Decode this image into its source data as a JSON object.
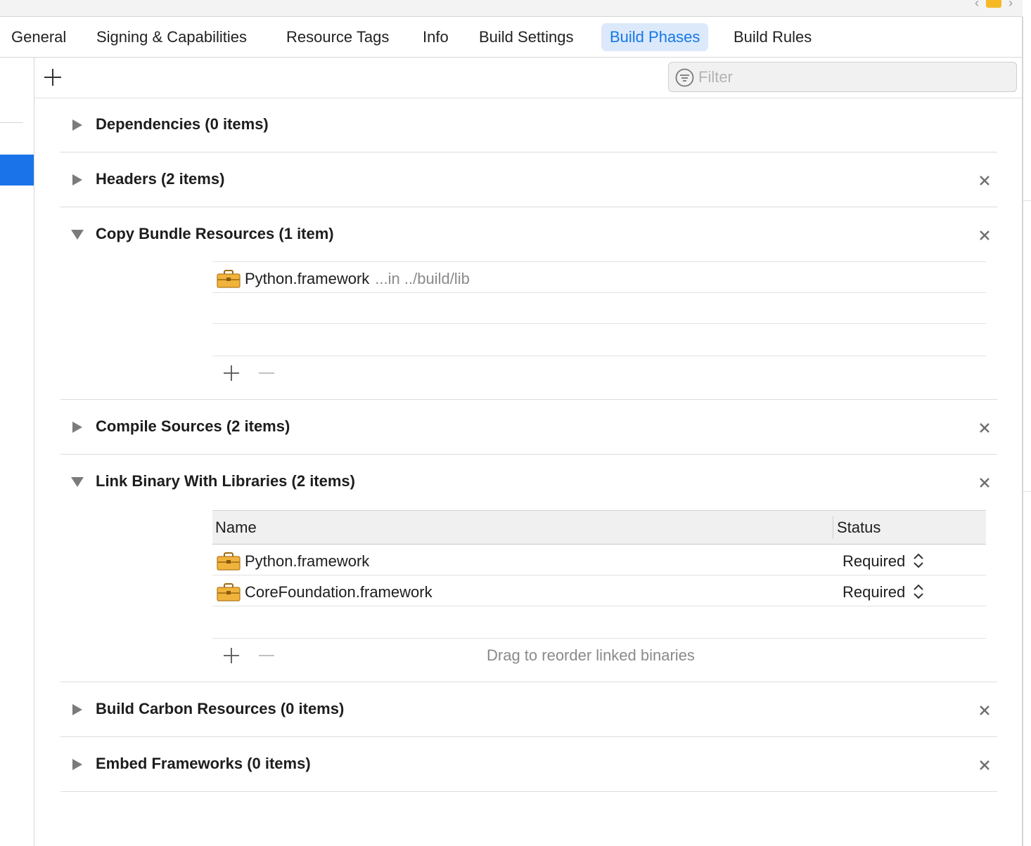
{
  "tabs": [
    {
      "label": "General",
      "active": false
    },
    {
      "label": "Signing & Capabilities",
      "active": false
    },
    {
      "label": "Resource Tags",
      "active": false
    },
    {
      "label": "Info",
      "active": false
    },
    {
      "label": "Build Settings",
      "active": false
    },
    {
      "label": "Build Phases",
      "active": true
    },
    {
      "label": "Build Rules",
      "active": false
    }
  ],
  "toolbar": {
    "filter_placeholder": "Filter"
  },
  "phases": {
    "dependencies": {
      "title": "Dependencies (0 items)",
      "expanded": false
    },
    "headers": {
      "title": "Headers (2 items)",
      "expanded": false
    },
    "copy_bundle": {
      "title": "Copy Bundle Resources (1 item)",
      "expanded": true,
      "items": [
        {
          "name": "Python.framework",
          "location": "...in ../build/lib"
        }
      ]
    },
    "compile_sources": {
      "title": "Compile Sources (2 items)",
      "expanded": false
    },
    "link_binary": {
      "title": "Link Binary With Libraries (2 items)",
      "expanded": true,
      "columns": {
        "name": "Name",
        "status": "Status"
      },
      "items": [
        {
          "name": "Python.framework",
          "status": "Required"
        },
        {
          "name": "CoreFoundation.framework",
          "status": "Required"
        }
      ],
      "hint": "Drag to reorder linked binaries"
    },
    "carbon_resources": {
      "title": "Build Carbon Resources (0 items)",
      "expanded": false
    },
    "embed_frameworks": {
      "title": "Embed Frameworks (0 items)",
      "expanded": false
    }
  },
  "colors": {
    "accent": "#1a73e8",
    "active_tab_bg": "#dbe9fb",
    "active_tab_text": "#1677e6",
    "framework_icon": "#f0b33c"
  },
  "icons": {
    "add_phase": "plus-icon",
    "filter": "filter-icon",
    "collapsed": "disclosure-right-icon",
    "expanded": "disclosure-down-icon",
    "delete_phase": "close-icon",
    "framework": "toolbox-icon",
    "status_select": "up-down-chevron-icon"
  }
}
